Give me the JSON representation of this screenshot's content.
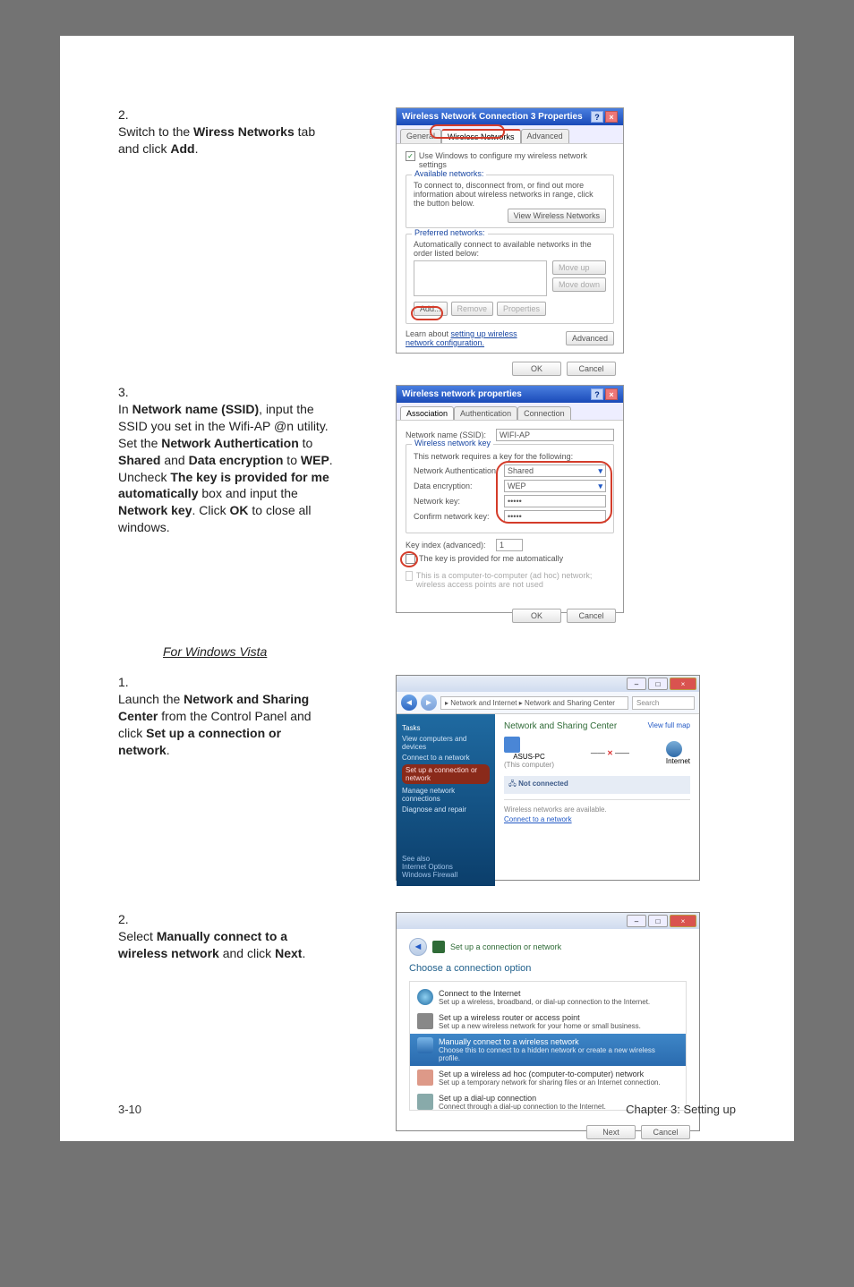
{
  "footer": {
    "left": "3-10",
    "right": "Chapter 3: Setting up"
  },
  "steps_xp": {
    "s2": {
      "num": "2.",
      "p1": "Switch to the ",
      "b1": "Wiress Networks",
      "p2": " tab and click ",
      "b2": "Add",
      "p3": "."
    },
    "s3": {
      "num": "3.",
      "p1": "In ",
      "b1": "Network name (SSID)",
      "p2": ", input the SSID you set in the Wifi-AP @n utility. Set the ",
      "b2": "Network Authertication",
      "p3": " to ",
      "b3": "Shared",
      "p4": " and ",
      "b4": "Data encryption",
      "p5": " to ",
      "b5": "WEP",
      "p6": ". Uncheck ",
      "b6": "The key is provided for me automatically",
      "p7": " box and input the ",
      "b7": "Network key",
      "p8": ". Click ",
      "b8": "OK",
      "p9": " to close all windows."
    }
  },
  "subheading": "For Windows Vista",
  "steps_vista": {
    "s1": {
      "num": "1.",
      "p1": "Launch the ",
      "b1": "Network and Sharing Center",
      "p2": " from the Control Panel and click ",
      "b2": "Set up a connection or network",
      "p3": "."
    },
    "s2": {
      "num": "2.",
      "p1": "Select ",
      "b1": "Manually connect to a wireless network",
      "p2": " and click ",
      "b2": "Next",
      "p3": "."
    }
  },
  "shot1": {
    "title": "Wireless Network Connection 3 Properties",
    "tab_general": "General",
    "tab_wireless": "Wireless Networks",
    "tab_advanced": "Advanced",
    "chk_usewin": "Use Windows to configure my wireless network settings",
    "fs1_legend": "Available networks:",
    "fs1_text": "To connect to, disconnect from, or find out more information about wireless networks in range, click the button below.",
    "btn_view": "View Wireless Networks",
    "fs2_legend": "Preferred networks:",
    "fs2_text": "Automatically connect to available networks in the order listed below:",
    "btn_moveup": "Move up",
    "btn_movedown": "Move down",
    "btn_add": "Add...",
    "btn_remove": "Remove",
    "btn_props": "Properties",
    "learn": "Learn about ",
    "learn_link": "setting up wireless network configuration.",
    "btn_adv": "Advanced",
    "ok": "OK",
    "cancel": "Cancel"
  },
  "shot2": {
    "title": "Wireless network properties",
    "tab_assoc": "Association",
    "tab_auth": "Authentication",
    "tab_conn": "Connection",
    "lbl_ssid": "Network name (SSID):",
    "val_ssid": "WIFI-AP",
    "fs_legend": "Wireless network key",
    "fs_note": "This network requires a key for the following:",
    "lbl_auth": "Network Authentication:",
    "val_auth": "Shared",
    "lbl_enc": "Data encryption:",
    "val_enc": "WEP",
    "lbl_key": "Network key:",
    "val_key": "•••••",
    "lbl_conf": "Confirm network key:",
    "val_conf": "•••••",
    "lbl_idx": "Key index (advanced):",
    "val_idx": "1",
    "chk_auto": "The key is provided for me automatically",
    "chk_adhoc": "This is a computer-to-computer (ad hoc) network; wireless access points are not used",
    "ok": "OK",
    "cancel": "Cancel"
  },
  "shot3": {
    "breadcrumb": "▸ Network and Internet ▸ Network and Sharing Center",
    "search": "Search",
    "side_tasks": "Tasks",
    "side_view": "View computers and devices",
    "side_connect": "Connect to a network",
    "side_setup": "Set up a connection or network",
    "side_manage": "Manage network connections",
    "side_diag": "Diagnose and repair",
    "side_see": "See also",
    "side_inet": "Internet Options",
    "side_fw": "Windows Firewall",
    "heading": "Network and Sharing Center",
    "viewmap": "View full map",
    "pc": "ASUS-PC",
    "pc_sub": "(This computer)",
    "inet": "Internet",
    "status": "Not connected",
    "line1": "Wireless networks are available.",
    "line2_link": "Connect to a network"
  },
  "shot4": {
    "wiz_title": "Set up a connection or network",
    "heading": "Choose a connection option",
    "opt1_t": "Connect to the Internet",
    "opt1_d": "Set up a wireless, broadband, or dial-up connection to the Internet.",
    "opt2_t": "Set up a wireless router or access point",
    "opt2_d": "Set up a new wireless network for your home or small business.",
    "opt3_t": "Manually connect to a wireless network",
    "opt3_d": "Choose this to connect to a hidden network or create a new wireless profile.",
    "opt4_t": "Set up a wireless ad hoc (computer-to-computer) network",
    "opt4_d": "Set up a temporary network for sharing files or an Internet connection.",
    "opt5_t": "Set up a dial-up connection",
    "opt5_d": "Connect through a dial-up connection to the Internet.",
    "next": "Next",
    "cancel": "Cancel"
  }
}
